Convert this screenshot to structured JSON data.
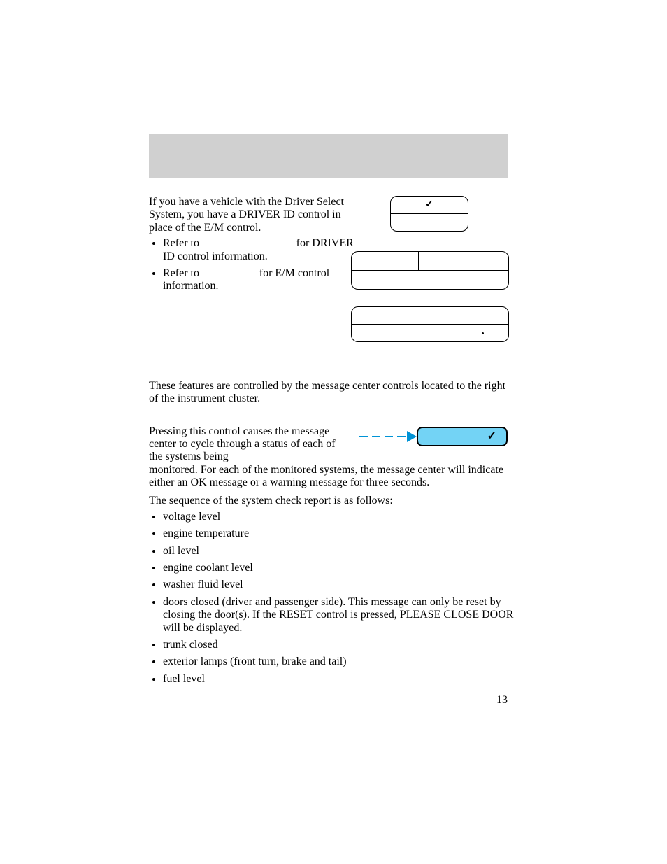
{
  "header": {
    "title": ""
  },
  "intro": {
    "text": "If you have a vehicle with the Driver Select System, you have a DRIVER ID control in place of the E/M control."
  },
  "bullets_top": [
    {
      "prefix": "Refer to ",
      "mid_blank": "",
      "suffix": " for DRIVER ID control information."
    },
    {
      "prefix": "Refer to ",
      "mid_blank": "",
      "suffix2_prefix": " for E/M control information."
    }
  ],
  "features_line": "These features are controlled by the message center controls located to the right of the instrument cluster.",
  "status_intro_short": "Pressing this control causes the message center to cycle through a status of each of the systems being",
  "status_intro_rest": "monitored. For each of the monitored systems, the message center will indicate either an OK message or a warning message for three seconds.",
  "sequence_line": "The sequence of the system check report is as follows:",
  "check_items": [
    "voltage level",
    "engine temperature",
    "oil level",
    "engine coolant level",
    "washer fluid level",
    "doors closed (driver and passenger side). This message can only be reset by closing the door(s). If the RESET control is pressed, PLEASE CLOSE DOOR will be displayed.",
    "trunk closed",
    "exterior lamps (front turn, brake and tail)",
    "fuel level"
  ],
  "page_number": "13",
  "icons": {
    "check": "✓"
  }
}
